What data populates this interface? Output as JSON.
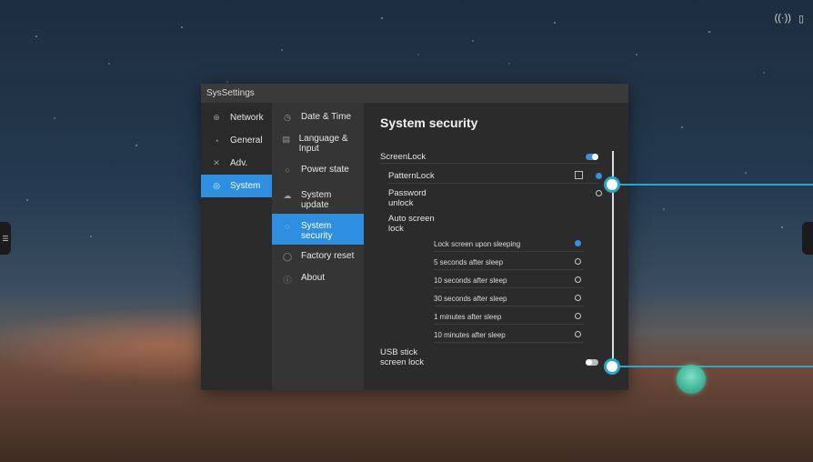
{
  "window": {
    "title": "SysSettings"
  },
  "nav_primary": [
    {
      "label": "Network",
      "icon": "globe-icon",
      "glyph": "⊕"
    },
    {
      "label": "General",
      "icon": "palette-icon",
      "glyph": "◔"
    },
    {
      "label": "Adv.",
      "icon": "tools-icon",
      "glyph": "✕"
    },
    {
      "label": "System",
      "icon": "system-icon",
      "glyph": "◎"
    }
  ],
  "nav_secondary": [
    {
      "label": "Date & Time",
      "icon": "clock-icon",
      "glyph": "◷"
    },
    {
      "label": "Language & Input",
      "icon": "keyboard-icon",
      "glyph": "▤"
    },
    {
      "label": "Power state",
      "icon": "power-icon",
      "glyph": "○"
    },
    {
      "label": "System update",
      "icon": "cloud-icon",
      "glyph": "☁"
    },
    {
      "label": "System security",
      "icon": "shield-icon",
      "glyph": "◌"
    },
    {
      "label": "Factory reset",
      "icon": "reset-icon",
      "glyph": "◯"
    },
    {
      "label": "About",
      "icon": "info-icon",
      "glyph": "ⓘ"
    }
  ],
  "content": {
    "title": "System security",
    "screenlock_label": "ScreenLock",
    "screenlock_on": true,
    "patternlock_label": "PatternLock",
    "password_label": "Password unlock",
    "auto_lock_label": "Auto screen lock",
    "auto_lock_options": [
      {
        "label": "Lock screen upon sleeping",
        "selected": true
      },
      {
        "label": "5 seconds after sleep",
        "selected": false
      },
      {
        "label": "10 seconds after sleep",
        "selected": false
      },
      {
        "label": "30 seconds after sleep",
        "selected": false
      },
      {
        "label": "1 minutes after sleep",
        "selected": false
      },
      {
        "label": "10 minutes after sleep",
        "selected": false
      }
    ],
    "usb_lock_label": "USB stick screen lock",
    "usb_lock_on": false
  },
  "colors": {
    "accent": "#2e8fe0",
    "callout": "#2aa6c9",
    "fab": "#3fb494"
  }
}
